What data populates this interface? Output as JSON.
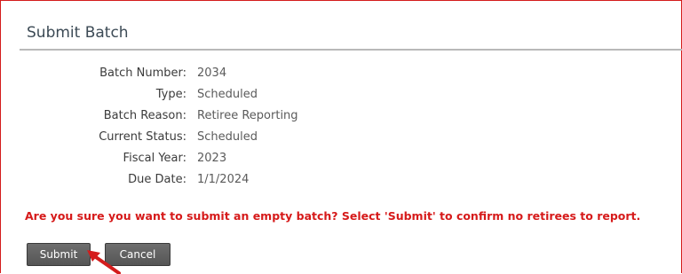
{
  "panel": {
    "title": "Submit Batch"
  },
  "details": [
    {
      "label": "Batch Number:",
      "value": "2034"
    },
    {
      "label": "Type:",
      "value": "Scheduled"
    },
    {
      "label": "Batch Reason:",
      "value": "Retiree Reporting"
    },
    {
      "label": "Current Status:",
      "value": "Scheduled"
    },
    {
      "label": "Fiscal Year:",
      "value": "2023"
    },
    {
      "label": "Due Date:",
      "value": "1/1/2024"
    }
  ],
  "warning": "Are you sure you want to submit an empty batch? Select 'Submit' to confirm no retirees to report.",
  "buttons": {
    "submit_label": "Submit",
    "cancel_label": "Cancel"
  },
  "colors": {
    "frame_border": "#d41c1c",
    "warning_text": "#d61a1a",
    "button_bg": "#5f5f5f",
    "annotation_arrow": "#d41c1c"
  }
}
